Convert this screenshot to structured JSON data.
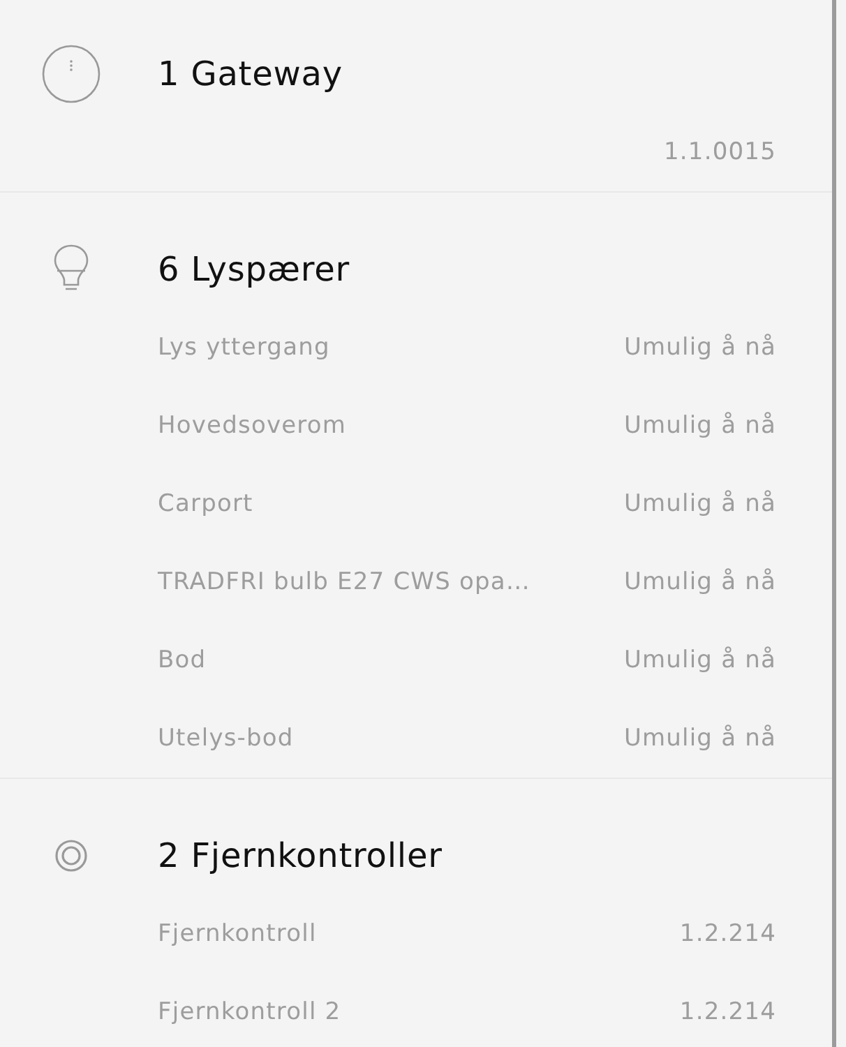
{
  "sections": [
    {
      "kind": "gateway",
      "title": "1 Gateway",
      "items": [
        {
          "value": "1.1.0015"
        }
      ]
    },
    {
      "kind": "bulb",
      "title": "6 Lyspærer",
      "items": [
        {
          "name": "Lys yttergang",
          "value": "Umulig å nå"
        },
        {
          "name": "Hovedsoverom",
          "value": "Umulig å nå"
        },
        {
          "name": "Carport",
          "value": "Umulig å nå"
        },
        {
          "name": "TRADFRI bulb E27 CWS opa…",
          "value": "Umulig å nå"
        },
        {
          "name": "Bod",
          "value": "Umulig å nå"
        },
        {
          "name": "Utelys-bod",
          "value": "Umulig å nå"
        }
      ]
    },
    {
      "kind": "remote",
      "title": "2 Fjernkontroller",
      "items": [
        {
          "name": "Fjernkontroll",
          "value": "1.2.214"
        },
        {
          "name": "Fjernkontroll 2",
          "value": "1.2.214"
        }
      ]
    }
  ]
}
